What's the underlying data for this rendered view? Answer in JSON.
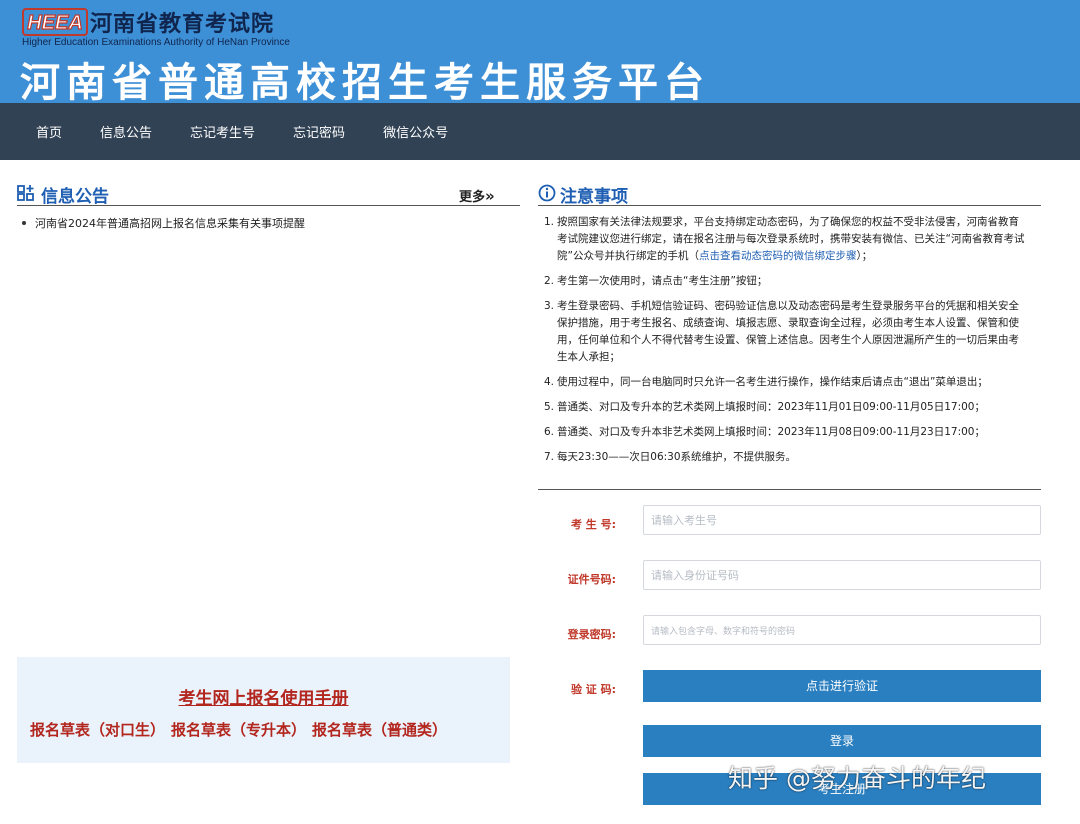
{
  "header": {
    "logo_text": "HEEA",
    "org_name_cn": "河南省教育考试院",
    "org_name_en": "Higher Education Examinations Authority of HeNan Province",
    "platform_title": "河南省普通高校招生考生服务平台",
    "bg_color": "#3d8fd6"
  },
  "nav": {
    "items": [
      "首页",
      "信息公告",
      "忘记考生号",
      "忘记密码",
      "微信公众号"
    ],
    "bg_color": "#314255"
  },
  "announcements": {
    "icon": "grid-icon",
    "title": "信息公告",
    "more_label": "更多",
    "more_icon": "double-chevron-right-icon",
    "items": [
      "河南省2024年普通高招网上报名信息采集有关事项提醒"
    ]
  },
  "manual": {
    "title": "考生网上报名使用手册",
    "links": [
      "报名草表（对口生）",
      "报名草表（专升本）",
      "报名草表（普通类）"
    ]
  },
  "notice": {
    "icon": "info-circle-icon",
    "title": "注意事项",
    "items": [
      {
        "num": "1.",
        "text": "按照国家有关法律法规要求，平台支持绑定动态密码，为了确保您的权益不受非法侵害，河南省教育考试院建议您进行绑定，请在报名注册与每次登录系统时，携带安装有微信、已关注“河南省教育考试院”公众号并执行绑定的手机（",
        "link": "点击查看动态密码的微信绑定步骤",
        "tail": "）；"
      },
      {
        "num": "2.",
        "text": "考生第一次使用时，请点击“考生注册”按钮；"
      },
      {
        "num": "3.",
        "text": "考生登录密码、手机短信验证码、密码验证信息以及动态密码是考生登录服务平台的凭据和相关安全保护措施，用于考生报名、成绩查询、填报志愿、录取查询全过程，必须由考生本人设置、保管和使用，任何单位和个人不得代替考生设置、保管上述信息。因考生个人原因泄漏所产生的一切后果由考生本人承担；"
      },
      {
        "num": "4.",
        "text": "使用过程中，同一台电脑同时只允许一名考生进行操作，操作结束后请点击“退出”菜单退出；"
      },
      {
        "num": "5.",
        "text": "普通类、对口及专升本的艺术类网上填报时间：2023年11月01日09:00-11月05日17:00；"
      },
      {
        "num": "6.",
        "text": "普通类、对口及专升本非艺术类网上填报时间：2023年11月08日09:00-11月23日17:00；"
      },
      {
        "num": "7.",
        "text": "每天23:30——次日06:30系统维护，不提供服务。"
      }
    ]
  },
  "login_form": {
    "candidate_no_label": "考 生 号:",
    "candidate_no_placeholder": "请输入考生号",
    "id_no_label": "证件号码:",
    "id_no_placeholder": "请输入身份证号码",
    "password_label": "登录密码:",
    "password_placeholder": "请输入包含字母、数字和符号的密码",
    "captcha_label": "验 证 码:",
    "verify_button": "点击进行验证",
    "login_button": "登录",
    "register_button": "考生注册",
    "accent_color": "#2a7fc0"
  },
  "watermark": "知乎 @努力奋斗的年纪"
}
